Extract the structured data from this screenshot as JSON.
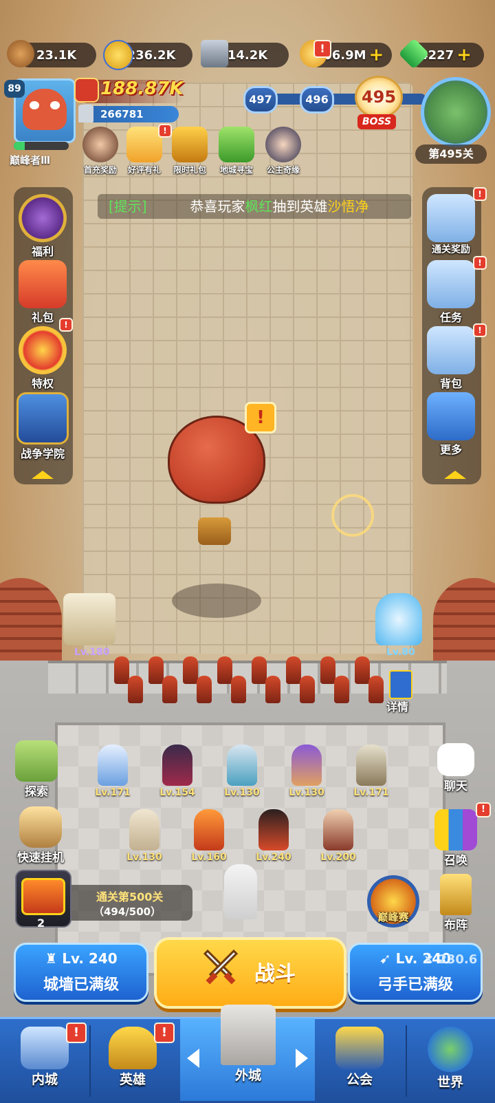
{
  "resources": [
    {
      "name": "wood",
      "value": "23.1K",
      "plus": ""
    },
    {
      "name": "star-coin",
      "value": "236.2K",
      "plus": ""
    },
    {
      "name": "iron",
      "value": "14.2K",
      "plus": ""
    },
    {
      "name": "gold",
      "value": "106.9M",
      "plus": "+"
    },
    {
      "name": "gem",
      "value": "4227",
      "plus": "+"
    }
  ],
  "player": {
    "level": "89",
    "rank_title": "巅峰者Ⅲ",
    "rank_progress": 0.2,
    "power": "188.87K",
    "score": "266781"
  },
  "quick_events": [
    {
      "label": "首充奖励",
      "badge": ""
    },
    {
      "label": "好评有礼",
      "badge": "!"
    },
    {
      "label": "限时礼包",
      "badge": ""
    },
    {
      "label": "地城寻宝",
      "badge": ""
    },
    {
      "label": "公主奇缘",
      "badge": ""
    }
  ],
  "stage": {
    "prev2": "497",
    "prev1": "496",
    "current": "495",
    "boss_label": "BOSS",
    "stage_label": "第495关"
  },
  "marquee": {
    "tag": "[提示]",
    "prefix": "恭喜玩家",
    "player": "枫红",
    "middle": "抽到英雄",
    "hero": "沙悟净"
  },
  "left_menu": [
    "福利",
    "礼包",
    "特权",
    "战争学院"
  ],
  "right_menu": [
    "通关奖励",
    "任务",
    "背包",
    "更多"
  ],
  "balloon_alert": "!",
  "towers": {
    "left_level": "Lv.180",
    "right_level": "Lv.80"
  },
  "details_label": "详情",
  "heroes_row1": [
    "Lv.171",
    "Lv.154",
    "Lv.130",
    "Lv.130",
    "Lv.171"
  ],
  "heroes_row2": [
    "Lv.130",
    "Lv.160",
    "Lv.240",
    "Lv.200"
  ],
  "left_actions": [
    "探索",
    "快速挂机"
  ],
  "right_actions": [
    "聊天",
    "召唤",
    "布阵"
  ],
  "chest": {
    "count": "2"
  },
  "clear_reward": {
    "title": "通关第500关",
    "progress": "（494/500）"
  },
  "peak_label": "巅峰赛",
  "wall": {
    "level": "Lv. 240",
    "status": "城墙已满级"
  },
  "fight": {
    "label": "战斗"
  },
  "archer": {
    "level": "Lv. 240",
    "status": "弓手已满级",
    "dps": "230.6"
  },
  "nav": [
    "内城",
    "英雄",
    "外城",
    "公会",
    "世界"
  ],
  "colors": {
    "accent": "#ffd21a",
    "nav_blue": "#2e6fcc",
    "highlight_green": "#5fe35a",
    "badge_red": "#e43d2e"
  }
}
